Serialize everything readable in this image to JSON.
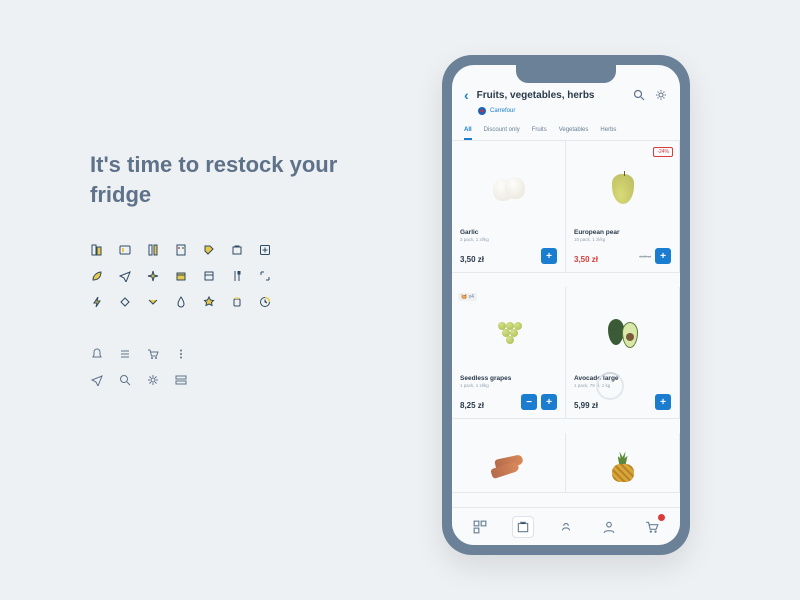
{
  "left": {
    "headline": "It's time to restock your fridge"
  },
  "header": {
    "title": "Fruits, vegetables, herbs",
    "store": "Carrefour"
  },
  "tabs": [
    "All",
    "Discount only",
    "Fruits",
    "Vegetables",
    "Herbs"
  ],
  "products": [
    {
      "name": "Garlic",
      "sub": "3 pack, 1 zł/kg",
      "price": "3,50 zł",
      "discount": null,
      "old": null,
      "basket": null
    },
    {
      "name": "European pear",
      "sub": "10 pack, 1 zł/kg",
      "price": "3,50 zł",
      "discount": "-24%",
      "old": "4,50 zł",
      "basket": null
    },
    {
      "name": "Seedless grapes",
      "sub": "1 pack, 1 zł/kg",
      "price": "8,25 zł",
      "discount": null,
      "old": null,
      "basket": "x4"
    },
    {
      "name": "Avocado large",
      "sub": "1 pack, 79 zł, 1 kg",
      "price": "5,99 zł",
      "discount": null,
      "old": null,
      "basket": null
    }
  ],
  "icon_names": {
    "row1": [
      "list-icon",
      "grid-icon",
      "sort-icon",
      "filter-icon",
      "tag-icon",
      "basket-icon",
      "plus-box-icon"
    ],
    "row2": [
      "leaf-icon",
      "send-icon",
      "sparkle-icon",
      "box-icon",
      "calendar-icon",
      "fork-knife-icon",
      "expand-icon"
    ],
    "row3": [
      "bolt-icon",
      "diamond-icon",
      "down-icon",
      "drop-icon",
      "star-icon",
      "jar-icon",
      "clock-icon"
    ],
    "row4": [
      "bell-icon",
      "menu-icon",
      "cart-icon",
      "more-icon"
    ],
    "row5": [
      "location-icon",
      "search-icon",
      "gear-icon",
      "slider-icon"
    ]
  }
}
